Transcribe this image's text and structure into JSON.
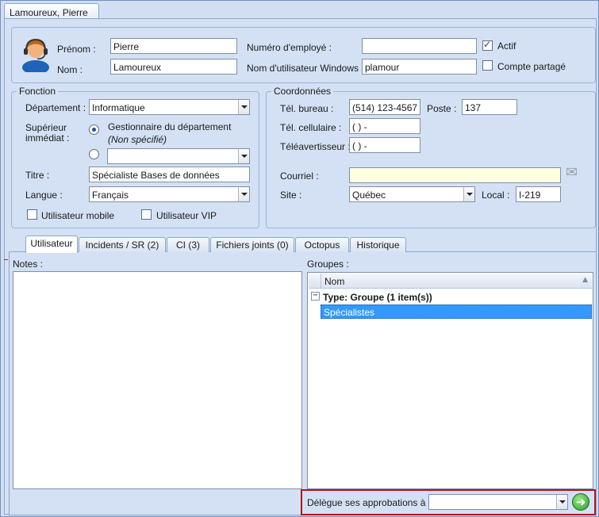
{
  "window_tab": "Lamoureux, Pierre",
  "identity": {
    "prenom_label": "Prénom :",
    "prenom_value": "Pierre",
    "nom_label": "Nom :",
    "nom_value": "Lamoureux",
    "employee_number_label": "Numéro d'employé :",
    "employee_number_value": "",
    "windows_user_label": "Nom d'utilisateur Windows :",
    "windows_user_value": "plamour",
    "actif_label": "Actif",
    "actif_checked": true,
    "shared_account_label": "Compte partagé",
    "shared_account_checked": false
  },
  "fonction": {
    "legend": "Fonction",
    "department_label": "Département :",
    "department_value": "Informatique",
    "supervisor_label_1": "Supérieur",
    "supervisor_label_2": "immédiat :",
    "radio_manager_label": "Gestionnaire du département",
    "radio_manager_note": "(Non spécifié)",
    "supervisor_combo_value": "",
    "title_label": "Titre :",
    "title_value": "Spécialiste Bases de données",
    "language_label": "Langue :",
    "language_value": "Français",
    "mobile_user_label": "Utilisateur mobile",
    "vip_user_label": "Utilisateur VIP"
  },
  "coordonnees": {
    "legend": "Coordonnées",
    "office_phone_label": "Tél. bureau :",
    "office_phone_value": "(514) 123-4567",
    "extension_label": "Poste :",
    "extension_value": "137",
    "cell_label": "Tél. cellulaire :",
    "cell_value": "(  )   -",
    "pager_label": "Téléavertisseur :",
    "pager_value": "(  )   -",
    "email_label": "Courriel :",
    "email_value": "",
    "site_label": "Site :",
    "site_value": "Québec",
    "local_label": "Local :",
    "local_value": "I-219"
  },
  "tabs": [
    {
      "label": "Utilisateur"
    },
    {
      "label": "Incidents / SR (2)"
    },
    {
      "label": "CI (3)"
    },
    {
      "label": "Fichiers joints (0)"
    },
    {
      "label": "Octopus"
    },
    {
      "label": "Historique"
    }
  ],
  "notes": {
    "label": "Notes :",
    "value": ""
  },
  "groups": {
    "label": "Groupes :",
    "column_name": "Nom",
    "group_row": "Type: Groupe (1 item(s))",
    "item": "Spécialistes"
  },
  "delegate": {
    "label": "Délègue ses approbations à :",
    "value": ""
  },
  "colors": {
    "accent_selection": "#3399ff",
    "highlight_border": "#b0161a"
  }
}
